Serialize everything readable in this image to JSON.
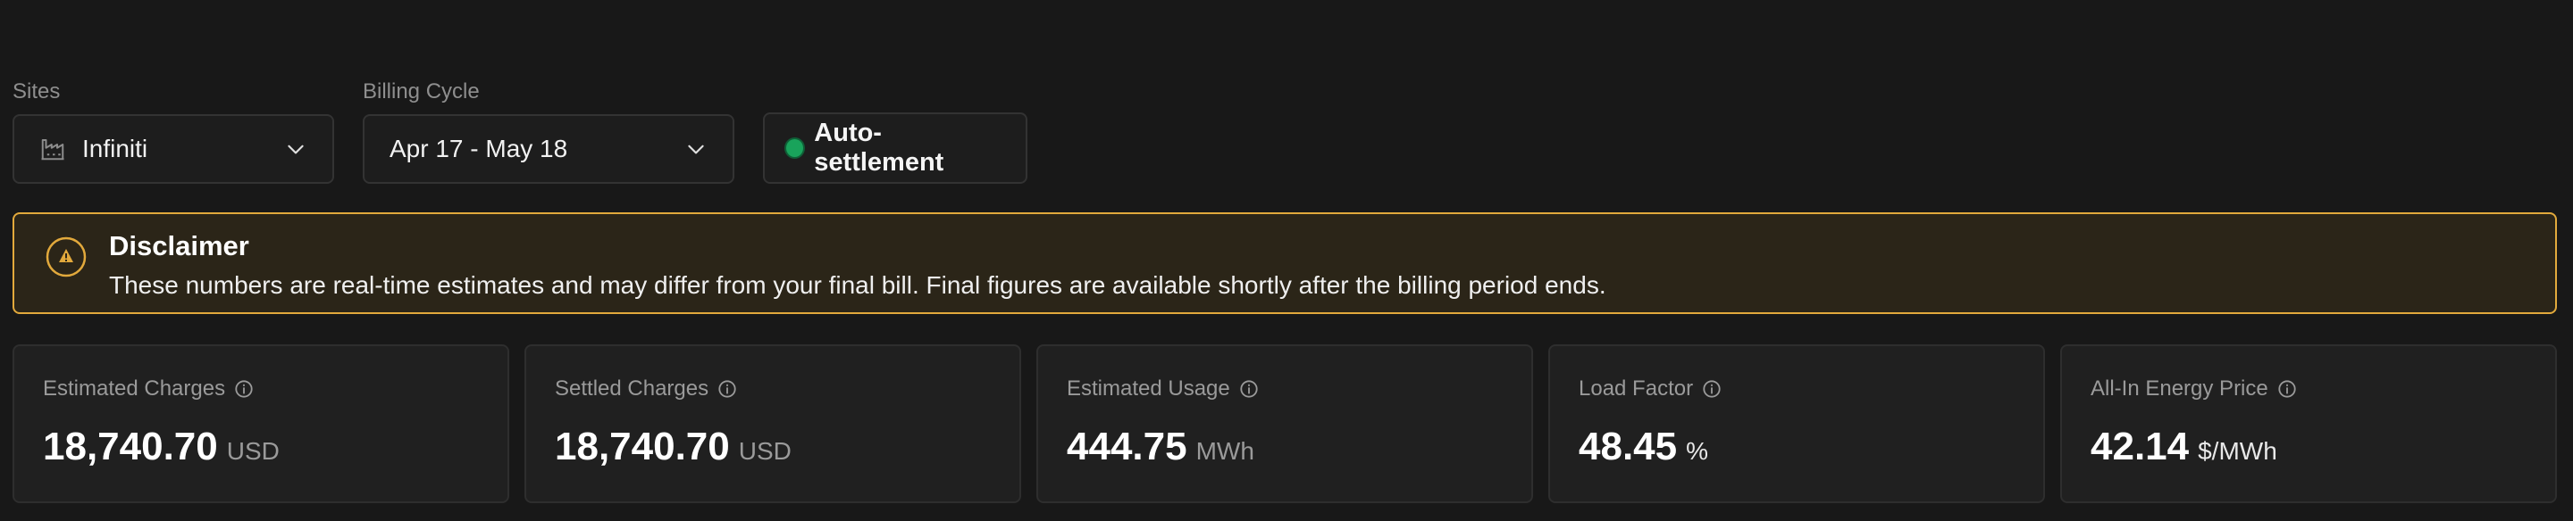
{
  "filters": {
    "sites": {
      "label": "Sites",
      "value": "Infiniti",
      "icon": "factory-icon"
    },
    "billing_cycle": {
      "label": "Billing Cycle",
      "value": "Apr 17 - May 18"
    },
    "auto_settlement": {
      "label": "Auto-settlement",
      "status_color": "#19a35b"
    }
  },
  "disclaimer": {
    "title": "Disclaimer",
    "text": "These numbers are real-time estimates and may differ from your final bill. Final figures are available shortly after the billing period ends.",
    "accent_color": "#e2a93c"
  },
  "metrics": [
    {
      "label": "Estimated Charges",
      "value": "18,740.70",
      "unit": "USD"
    },
    {
      "label": "Settled Charges",
      "value": "18,740.70",
      "unit": "USD"
    },
    {
      "label": "Estimated Usage",
      "value": "444.75",
      "unit": "MWh"
    },
    {
      "label": "Load Factor",
      "value": "48.45",
      "unit": "%"
    },
    {
      "label": "All-In Energy Price",
      "value": "42.14",
      "unit": "$/MWh"
    }
  ]
}
